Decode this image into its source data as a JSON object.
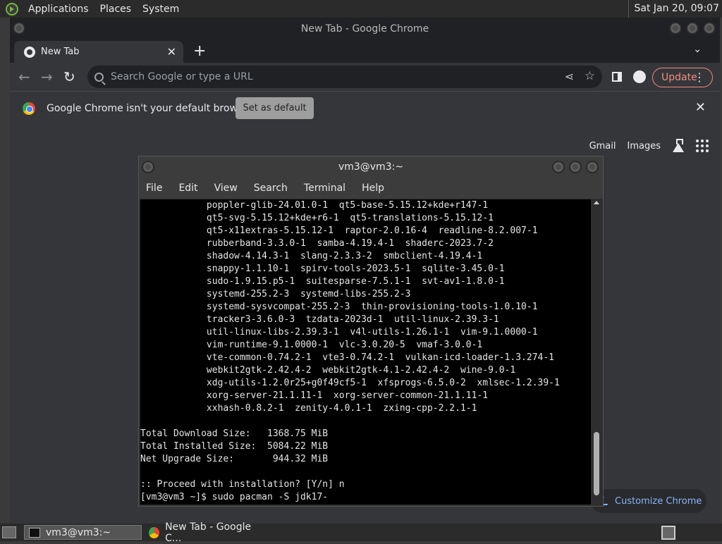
{
  "top_panel": {
    "menus": [
      "Applications",
      "Places",
      "System"
    ],
    "clock": "Sat Jan 20, 09:07"
  },
  "chrome": {
    "window_title": "New Tab - Google Chrome",
    "tab_title": "New Tab",
    "omnibox_placeholder": "Search Google or type a URL",
    "update_label": "Update",
    "infobar_message": "Google Chrome isn't your default browser",
    "set_default_label": "Set as default",
    "ntp_links": [
      "Gmail",
      "Images"
    ],
    "customize_label": "Customize Chrome"
  },
  "terminal": {
    "title": "vm3@vm3:~",
    "menus": [
      "File",
      "Edit",
      "View",
      "Search",
      "Terminal",
      "Help"
    ],
    "lines": [
      "            poppler-glib-24.01.0-1  qt5-base-5.15.12+kde+r147-1",
      "            qt5-svg-5.15.12+kde+r6-1  qt5-translations-5.15.12-1",
      "            qt5-x11extras-5.15.12-1  raptor-2.0.16-4  readline-8.2.007-1",
      "            rubberband-3.3.0-1  samba-4.19.4-1  shaderc-2023.7-2",
      "            shadow-4.14.3-1  slang-2.3.3-2  smbclient-4.19.4-1",
      "            snappy-1.1.10-1  spirv-tools-2023.5-1  sqlite-3.45.0-1",
      "            sudo-1.9.15.p5-1  suitesparse-7.5.1-1  svt-av1-1.8.0-1",
      "            systemd-255.2-3  systemd-libs-255.2-3",
      "            systemd-sysvcompat-255.2-3  thin-provisioning-tools-1.0.10-1",
      "            tracker3-3.6.0-3  tzdata-2023d-1  util-linux-2.39.3-1",
      "            util-linux-libs-2.39.3-1  v4l-utils-1.26.1-1  vim-9.1.0000-1",
      "            vim-runtime-9.1.0000-1  vlc-3.0.20-5  vmaf-3.0.0-1",
      "            vte-common-0.74.2-1  vte3-0.74.2-1  vulkan-icd-loader-1.3.274-1",
      "            webkit2gtk-2.42.4-2  webkit2gtk-4.1-2.42.4-2  wine-9.0-1",
      "            xdg-utils-1.2.0r25+g0f49cf5-1  xfsprogs-6.5.0-2  xmlsec-1.2.39-1",
      "            xorg-server-21.1.11-1  xorg-server-common-21.1.11-1",
      "            xxhash-0.8.2-1  zenity-4.0.1-1  zxing-cpp-2.2.1-1",
      "",
      "Total Download Size:   1368.75 MiB",
      "Total Installed Size:  5084.22 MiB",
      "Net Upgrade Size:       944.32 MiB",
      "",
      ":: Proceed with installation? [Y/n] n",
      "[vm3@vm3 ~]$ sudo pacman -S jdk17-"
    ]
  },
  "taskbar": {
    "tasks": [
      "vm3@vm3:~",
      "New Tab - Google C..."
    ]
  }
}
